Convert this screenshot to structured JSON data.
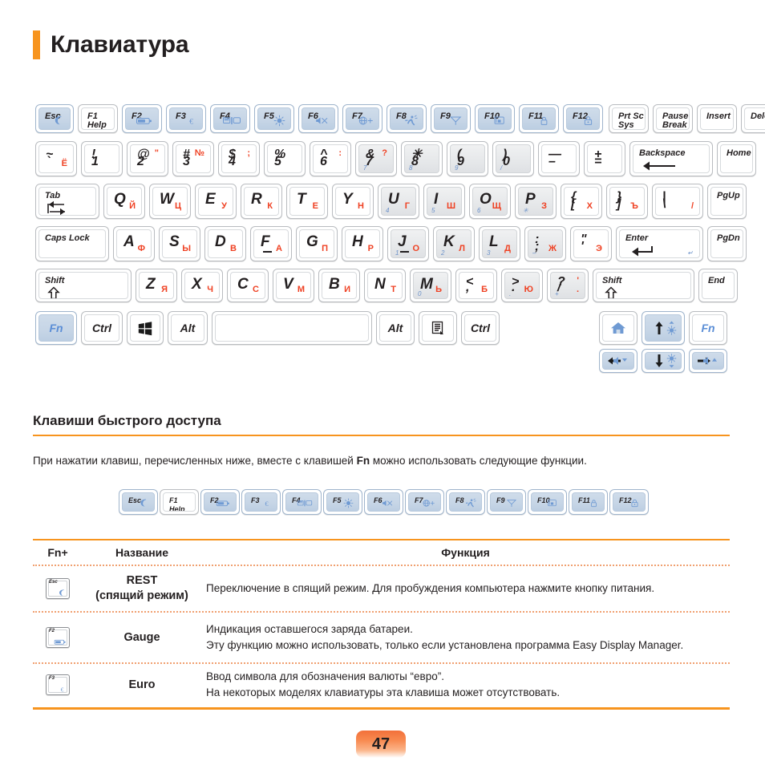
{
  "page": {
    "title": "Клавиатура",
    "number": "47",
    "accent_color": "#f7941e",
    "cyrillic_color": "#ef4123",
    "fn_blue": "#5b8ed6"
  },
  "keyboard": {
    "row_fn": [
      {
        "label": "Esc",
        "icon": "moon-icon",
        "style": "fn-blue"
      },
      {
        "label": "F1",
        "sub": "Help",
        "style": "white"
      },
      {
        "label": "F2",
        "icon": "battery-icon",
        "style": "fn-blue"
      },
      {
        "label": "F3",
        "icon": "euro-icon",
        "style": "fn-blue"
      },
      {
        "label": "F4",
        "icon": "display-switch-icon",
        "style": "fn-blue"
      },
      {
        "label": "F5",
        "icon": "brightness-icon",
        "style": "fn-blue"
      },
      {
        "label": "F6",
        "icon": "mute-icon",
        "style": "fn-blue"
      },
      {
        "label": "F7",
        "icon": "network-icon",
        "style": "fn-blue"
      },
      {
        "label": "F8",
        "icon": "performance-icon",
        "style": "fn-blue"
      },
      {
        "label": "F9",
        "icon": "touchpad-icon",
        "style": "fn-blue"
      },
      {
        "label": "F10",
        "icon": "screen-lock-icon",
        "style": "fn-blue"
      },
      {
        "label": "F11",
        "icon": "lock-icon",
        "style": "fn-blue"
      },
      {
        "label": "F12",
        "icon": "secure-lock-icon",
        "style": "fn-blue"
      },
      {
        "label": "Prt Sc",
        "sub": "Sys Rq",
        "style": "white"
      },
      {
        "label": "Pause",
        "sub": "Break",
        "style": "white"
      },
      {
        "label": "Insert",
        "style": "white"
      },
      {
        "label": "Delete",
        "style": "white"
      }
    ],
    "row_num": [
      {
        "up": "~",
        "low": "`",
        "ru": "Ё",
        "style": "white"
      },
      {
        "up": "!",
        "low": "1",
        "style": "white"
      },
      {
        "up": "@",
        "low": "2",
        "ru_top": "\"",
        "style": "white"
      },
      {
        "up": "#",
        "low": "3",
        "ru_top": "№",
        "style": "white"
      },
      {
        "up": "$",
        "low": "4",
        "ru_top": ";",
        "style": "white"
      },
      {
        "up": "%",
        "low": "5",
        "style": "white"
      },
      {
        "up": "^",
        "low": "6",
        "ru_top": ":",
        "style": "white"
      },
      {
        "up": "&",
        "low": "7",
        "ru_top": "?",
        "style": "num-grey",
        "numpad": "7"
      },
      {
        "up": "✳",
        "low": "8",
        "style": "num-grey",
        "numpad": "8"
      },
      {
        "up": "(",
        "low": "9",
        "style": "num-grey",
        "numpad": "9"
      },
      {
        "up": ")",
        "low": "0",
        "style": "num-grey",
        "numpad": "/"
      },
      {
        "up": "—",
        "low": "–",
        "style": "white"
      },
      {
        "up": "+",
        "low": "=",
        "style": "white"
      },
      {
        "label": "Backspace",
        "icon": "backspace-arrow-icon",
        "style": "white"
      },
      {
        "label": "Home",
        "style": "white"
      }
    ],
    "row_q": [
      {
        "label": "Tab",
        "icon": "tab-arrows-icon",
        "style": "white"
      },
      {
        "big": "Q",
        "ru": "Й",
        "style": "white"
      },
      {
        "big": "W",
        "ru": "Ц",
        "style": "white"
      },
      {
        "big": "E",
        "ru": "У",
        "style": "white"
      },
      {
        "big": "R",
        "ru": "К",
        "style": "white"
      },
      {
        "big": "T",
        "ru": "Е",
        "style": "white"
      },
      {
        "big": "Y",
        "ru": "Н",
        "style": "white"
      },
      {
        "big": "U",
        "ru": "Г",
        "style": "num-grey",
        "numpad": "4"
      },
      {
        "big": "I",
        "ru": "Ш",
        "style": "num-grey",
        "numpad": "5"
      },
      {
        "big": "O",
        "ru": "Щ",
        "style": "num-grey",
        "numpad": "6"
      },
      {
        "big": "P",
        "ru": "З",
        "style": "num-grey",
        "numpad": "✳"
      },
      {
        "up": "{",
        "low": "[",
        "ru": "Х",
        "style": "white"
      },
      {
        "up": "}",
        "low": "]",
        "ru": "Ъ",
        "style": "white"
      },
      {
        "up": "|",
        "low": "\\",
        "ru": "/",
        "style": "white"
      },
      {
        "label": "PgUp",
        "style": "white"
      }
    ],
    "row_a": [
      {
        "label": "Caps Lock",
        "style": "white"
      },
      {
        "big": "A",
        "ru": "Ф",
        "style": "white"
      },
      {
        "big": "S",
        "ru": "Ы",
        "style": "white"
      },
      {
        "big": "D",
        "ru": "В",
        "style": "white"
      },
      {
        "big": "F",
        "ru": "А",
        "homebar": true,
        "style": "white"
      },
      {
        "big": "G",
        "ru": "П",
        "style": "white"
      },
      {
        "big": "H",
        "ru": "Р",
        "style": "white"
      },
      {
        "big": "J",
        "ru": "О",
        "homebar": true,
        "style": "num-grey",
        "numpad": "1"
      },
      {
        "big": "K",
        "ru": "Л",
        "style": "num-grey",
        "numpad": "2"
      },
      {
        "big": "L",
        "ru": "Д",
        "style": "num-grey",
        "numpad": "3"
      },
      {
        "up": ":",
        "low": ";",
        "ru": "Ж",
        "style": "num-grey",
        "numpad": "–"
      },
      {
        "up": "\"",
        "low": "'",
        "ru": "Э",
        "style": "white"
      },
      {
        "label": "Enter",
        "icon": "enter-arrow-icon",
        "style": "white",
        "numpad": "enter"
      },
      {
        "label": "PgDn",
        "style": "white"
      }
    ],
    "row_z": [
      {
        "label": "Shift",
        "icon": "shift-up-icon",
        "style": "white"
      },
      {
        "big": "Z",
        "ru": "Я",
        "style": "white"
      },
      {
        "big": "X",
        "ru": "Ч",
        "style": "white"
      },
      {
        "big": "C",
        "ru": "С",
        "style": "white"
      },
      {
        "big": "V",
        "ru": "М",
        "style": "white"
      },
      {
        "big": "B",
        "ru": "И",
        "style": "white"
      },
      {
        "big": "N",
        "ru": "Т",
        "style": "white"
      },
      {
        "big": "M",
        "ru": "Ь",
        "style": "num-grey",
        "numpad": "0"
      },
      {
        "up": "<",
        "low": ",",
        "ru": "Б",
        "style": "white"
      },
      {
        "up": ">",
        "low": ".",
        "ru": "Ю",
        "style": "num-grey",
        "numpad": "."
      },
      {
        "up": "?",
        "low": "/",
        "ru_top": "'",
        "ru": ".",
        "style": "num-grey",
        "numpad": "+"
      },
      {
        "label": "Shift",
        "icon": "shift-up-icon",
        "style": "white"
      },
      {
        "label": "End",
        "style": "white"
      }
    ],
    "row_bottom": [
      {
        "label": "Fn",
        "style": "fn-blue",
        "blue_text": true
      },
      {
        "label": "Ctrl",
        "style": "white"
      },
      {
        "icon": "windows-icon",
        "style": "white"
      },
      {
        "label": "Alt",
        "style": "white"
      },
      {
        "label": "",
        "style": "white",
        "name": "spacebar"
      },
      {
        "label": "Alt",
        "style": "white"
      },
      {
        "icon": "menu-icon",
        "style": "white"
      },
      {
        "label": "Ctrl",
        "style": "white"
      },
      {
        "icon": "home-icon",
        "style": "white"
      },
      {
        "icon": "arrow-up-icon",
        "sub_icon": "brightness-up-icon",
        "style": "fn-blue"
      },
      {
        "label": "Fn",
        "style": "white",
        "blue_text": true
      },
      {
        "icon": "arrow-left-icon",
        "sub_icon": "volume-down-icon",
        "style": "fn-blue"
      },
      {
        "icon": "arrow-down-icon",
        "sub_icon": "brightness-down-icon",
        "style": "fn-blue"
      },
      {
        "icon": "arrow-right-icon",
        "sub_icon": "volume-up-icon",
        "style": "fn-blue"
      }
    ]
  },
  "section": {
    "heading": "Клавиши быстрого доступа",
    "paragraph_before": "При нажатии клавиш, перечисленных ниже, вместе с клавишей ",
    "paragraph_bold": "Fn",
    "paragraph_after": " можно использовать следующие функции.",
    "strip": [
      {
        "label": "Esc",
        "icon": "moon-icon",
        "style": "fn-blue"
      },
      {
        "label": "F1",
        "sub": "Help",
        "style": "white"
      },
      {
        "label": "F2",
        "icon": "battery-icon",
        "style": "fn-blue"
      },
      {
        "label": "F3",
        "icon": "euro-icon",
        "style": "fn-blue"
      },
      {
        "label": "F4",
        "icon": "display-switch-icon",
        "style": "fn-blue"
      },
      {
        "label": "F5",
        "icon": "brightness-icon",
        "style": "fn-blue"
      },
      {
        "label": "F6",
        "icon": "mute-icon",
        "style": "fn-blue"
      },
      {
        "label": "F7",
        "icon": "network-icon",
        "style": "fn-blue"
      },
      {
        "label": "F8",
        "icon": "performance-icon",
        "style": "fn-blue"
      },
      {
        "label": "F9",
        "icon": "touchpad-icon",
        "style": "fn-blue"
      },
      {
        "label": "F10",
        "icon": "screen-lock-icon",
        "style": "fn-blue"
      },
      {
        "label": "F11",
        "icon": "lock-icon",
        "style": "fn-blue"
      },
      {
        "label": "F12",
        "icon": "secure-lock-icon",
        "style": "fn-blue"
      }
    ]
  },
  "table": {
    "headers": {
      "fn": "Fn+",
      "name": "Название",
      "func": "Функция"
    },
    "rows": [
      {
        "key_label": "Esc",
        "key_icon": "moon-icon",
        "name_line1": "REST",
        "name_line2": "(спящий режим)",
        "func_lines": [
          "Переключение в спящий режим. Для пробуждения компьютера нажмите кнопку питания."
        ]
      },
      {
        "key_label": "F2",
        "key_icon": "battery-icon",
        "name_line1": "Gauge",
        "name_line2": "",
        "func_lines": [
          "Индикация оставшегося заряда батареи.",
          "Эту функцию можно использовать, только если установлена программа Easy Display Manager."
        ]
      },
      {
        "key_label": "F3",
        "key_icon": "euro-icon",
        "name_line1": "Euro",
        "name_line2": "",
        "func_lines": [
          "Ввод символа для обозначения валюты “евро”.",
          "На некоторых моделях клавиатуры эта клавиша может отсутствовать."
        ]
      }
    ]
  }
}
